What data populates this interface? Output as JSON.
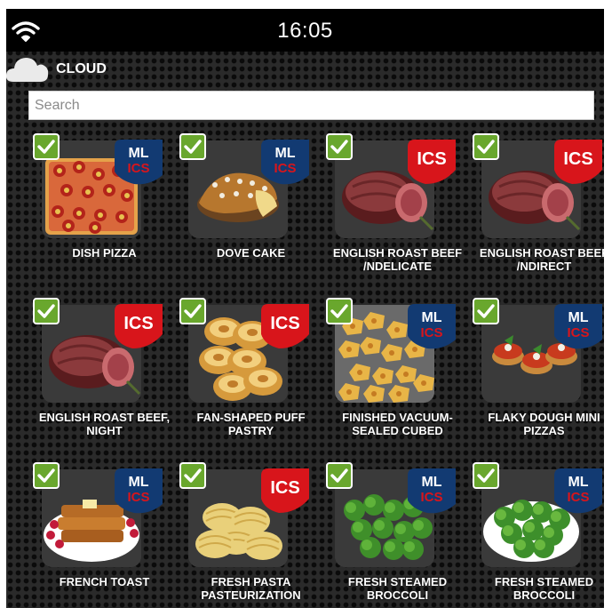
{
  "status_bar": {
    "time": "16:05",
    "wifi_icon": "wifi-icon"
  },
  "source": {
    "label": "CLOUD",
    "icon": "cloud-icon"
  },
  "search": {
    "placeholder": "Search",
    "value": ""
  },
  "colors": {
    "check": "#69a72d",
    "badge_red": "#d8151b",
    "badge_navy": "#123a72",
    "background": "#2a2a2a"
  },
  "recipes": [
    {
      "label": "DISH PIZZA",
      "badge": "ML ICS",
      "image": "pizza",
      "selected": true
    },
    {
      "label": "DOVE CAKE",
      "badge": "ML ICS",
      "image": "cake",
      "selected": true
    },
    {
      "label": "ENGLISH ROAST BEEF /NDELICATE",
      "badge": "ICS",
      "image": "roast-beef",
      "selected": true
    },
    {
      "label": "ENGLISH ROAST BEEF /NDIRECT",
      "badge": "ICS",
      "image": "roast-beef",
      "selected": true
    },
    {
      "label": "ENGLISH ROAST BEEF, NIGHT",
      "badge": "ICS",
      "image": "roast-beef",
      "selected": true
    },
    {
      "label": "FAN-SHAPED PUFF PASTRY",
      "badge": "ICS",
      "image": "puff-pastry",
      "selected": true
    },
    {
      "label": "FINISHED VACUUM-SEALED CUBED",
      "badge": "ML ICS",
      "image": "potatoes",
      "selected": true
    },
    {
      "label": "FLAKY DOUGH MINI PIZZAS",
      "badge": "ML ICS",
      "image": "mini-pizzas",
      "selected": true
    },
    {
      "label": "FRENCH TOAST",
      "badge": "ML ICS",
      "image": "french-toast",
      "selected": true
    },
    {
      "label": "FRESH PASTA PASTEURIZATION",
      "badge": "ICS",
      "image": "pasta",
      "selected": true
    },
    {
      "label": "FRESH STEAMED BROCCOLI",
      "badge": "ML ICS",
      "image": "broccoli",
      "selected": true
    },
    {
      "label": "FRESH STEAMED BROCCOLI",
      "badge": "ML ICS",
      "image": "broccoli-plate",
      "selected": true
    }
  ]
}
